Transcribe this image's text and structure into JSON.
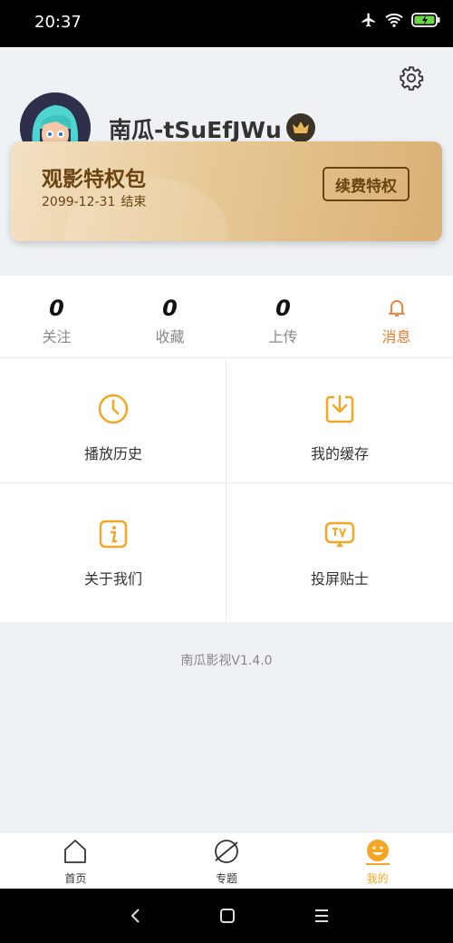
{
  "status_bar": {
    "time": "20:37"
  },
  "profile": {
    "username": "南瓜-tSuEfJWu"
  },
  "vip_card": {
    "title": "观影特权包",
    "expire_date": "2099-12-31",
    "expire_suffix": "结束",
    "renew_label": "续费特权"
  },
  "stats": [
    {
      "value": "0",
      "label": "关注"
    },
    {
      "value": "0",
      "label": "收藏"
    },
    {
      "value": "0",
      "label": "上传"
    },
    {
      "label": "消息"
    }
  ],
  "menu": [
    {
      "label": "播放历史",
      "icon": "clock-icon"
    },
    {
      "label": "我的缓存",
      "icon": "download-icon"
    },
    {
      "label": "关于我们",
      "icon": "info-icon"
    },
    {
      "label": "投屏贴士",
      "icon": "tv-icon"
    }
  ],
  "version": "南瓜影视V1.4.0",
  "tabs": [
    {
      "label": "首页",
      "icon": "home-icon"
    },
    {
      "label": "专题",
      "icon": "planet-icon"
    },
    {
      "label": "我的",
      "icon": "smiley-icon",
      "active": true
    }
  ],
  "colors": {
    "accent": "#f5a623",
    "notice": "#f07a2c",
    "vip_text": "#6a4312"
  }
}
